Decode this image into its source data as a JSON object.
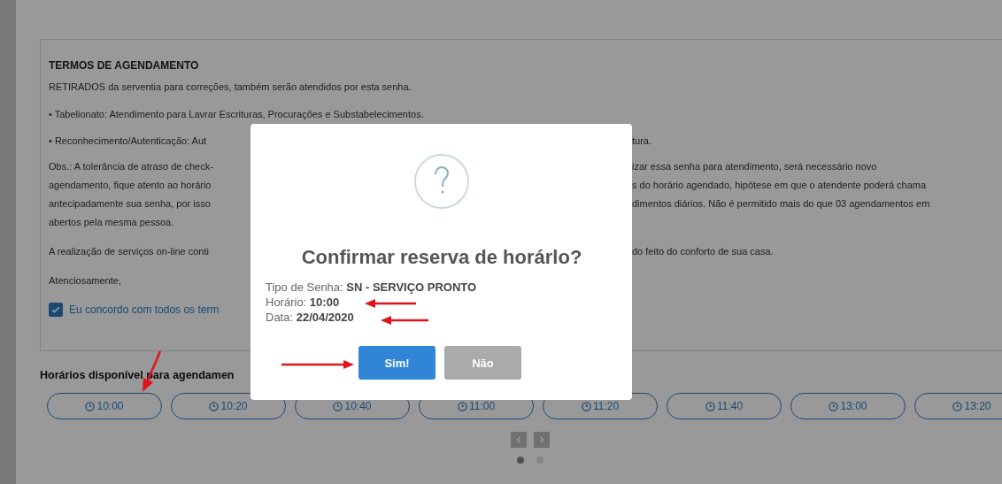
{
  "terms": {
    "title": "TERMOS DE AGENDAMENTO",
    "lines": [
      {
        "left": "RETIRADOS da serventia para correções, também serão atendidos por esta senha."
      },
      {
        "left": "• Tabelionato: Atendimento para Lavrar Escrituras, Procurações e Substabelecimentos."
      },
      {
        "left": "• Reconhecimento/Autenticação: Aut",
        "right": "tura."
      },
      {
        "left": "Obs.: A tolerância de atraso de check-",
        "right": "izar essa senha para atendimento, será necessário novo"
      },
      {
        "left": "agendamento, fique atento ao horário",
        "right": "s do horário agendado, hipótese em que o atendente poderá chama"
      },
      {
        "left": "antecipadamente sua senha, por isso",
        "right": "dimentos diários. Não é permitido mais do que 03 agendamentos em"
      },
      {
        "left": "abertos pela mesma pessoa."
      },
      {
        "left": "A realização de serviços on-line conti",
        "right": "do feito do conforto de sua casa."
      },
      {
        "left": "Atenciosamente,"
      }
    ],
    "agree": {
      "label": "Eu concordo com todos os term",
      "checked": true
    }
  },
  "schedule": {
    "title": "Horários disponível para agendamen",
    "times": [
      {
        "label": "10:00"
      },
      {
        "label": "10:20"
      },
      {
        "label": "10:40"
      },
      {
        "label": "11:00"
      },
      {
        "label": "11:20"
      },
      {
        "label": "11:40"
      },
      {
        "label": "13:00"
      },
      {
        "label": "13:20"
      }
    ],
    "pages": [
      {
        "selected": true
      },
      {
        "selected": false
      }
    ]
  },
  "dialog": {
    "title": "Confirmar reserva de horárlo?",
    "details": [
      {
        "label": "Tipo de Senha:",
        "value": "SN - SERVIÇO PRONTO"
      },
      {
        "label": "Horário:",
        "value": "10:00"
      },
      {
        "label": "Data:",
        "value": "22/04/2020"
      }
    ],
    "buttons": [
      {
        "label": "Sim!",
        "kind": "confirm"
      },
      {
        "label": "Não",
        "kind": "cancel"
      }
    ]
  }
}
